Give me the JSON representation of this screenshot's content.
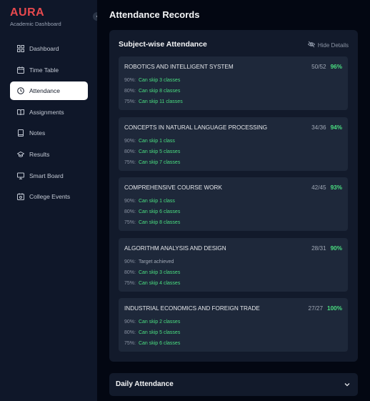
{
  "brand": {
    "name": "AURA",
    "subtitle": "Academic Dashboard"
  },
  "sidebar": {
    "items": [
      {
        "label": "Dashboard",
        "icon": "grid-icon",
        "active": false
      },
      {
        "label": "Time Table",
        "icon": "calendar-icon",
        "active": false
      },
      {
        "label": "Attendance",
        "icon": "clock-icon",
        "active": true
      },
      {
        "label": "Assignments",
        "icon": "book-open-icon",
        "active": false
      },
      {
        "label": "Notes",
        "icon": "notebook-icon",
        "active": false
      },
      {
        "label": "Results",
        "icon": "graduation-cap-icon",
        "active": false
      },
      {
        "label": "Smart Board",
        "icon": "monitor-icon",
        "active": false
      },
      {
        "label": "College Events",
        "icon": "calendar-event-icon",
        "active": false
      }
    ]
  },
  "main": {
    "title": "Attendance Records",
    "panel": {
      "title": "Subject-wise Attendance",
      "hide_label": "Hide Details",
      "subjects": [
        {
          "name": "ROBOTICS AND INTELLIGENT SYSTEM",
          "ratio": "50/52",
          "percent": "96%",
          "rows": [
            {
              "label": "90%:",
              "value": "Can skip 3 classes"
            },
            {
              "label": "80%:",
              "value": "Can skip 8 classes"
            },
            {
              "label": "75%:",
              "value": "Can skip 11 classes"
            }
          ]
        },
        {
          "name": "CONCEPTS IN NATURAL LANGUAGE PROCESSING",
          "ratio": "34/36",
          "percent": "94%",
          "rows": [
            {
              "label": "90%:",
              "value": "Can skip 1 class"
            },
            {
              "label": "80%:",
              "value": "Can skip 5 classes"
            },
            {
              "label": "75%:",
              "value": "Can skip 7 classes"
            }
          ]
        },
        {
          "name": "COMPREHENSIVE COURSE WORK",
          "ratio": "42/45",
          "percent": "93%",
          "rows": [
            {
              "label": "90%:",
              "value": "Can skip 1 class"
            },
            {
              "label": "80%:",
              "value": "Can skip 6 classes"
            },
            {
              "label": "75%:",
              "value": "Can skip 8 classes"
            }
          ]
        },
        {
          "name": "ALGORITHM ANALYSIS AND DESIGN",
          "ratio": "28/31",
          "percent": "90%",
          "rows": [
            {
              "label": "90%:",
              "value": "Target achieved"
            },
            {
              "label": "80%:",
              "value": "Can skip 3 classes"
            },
            {
              "label": "75%:",
              "value": "Can skip 4 classes"
            }
          ]
        },
        {
          "name": "INDUSTRIAL ECONOMICS AND FOREIGN TRADE",
          "ratio": "27/27",
          "percent": "100%",
          "rows": [
            {
              "label": "90%:",
              "value": "Can skip 2 classes"
            },
            {
              "label": "80%:",
              "value": "Can skip 5 classes"
            },
            {
              "label": "75%:",
              "value": "Can skip 6 classes"
            }
          ]
        }
      ]
    },
    "daily": {
      "title": "Daily Attendance"
    }
  },
  "colors": {
    "brand": "#e8494e",
    "positive": "#4ade80",
    "sidebar_bg": "#0f1729",
    "card_bg": "#1e283a"
  }
}
